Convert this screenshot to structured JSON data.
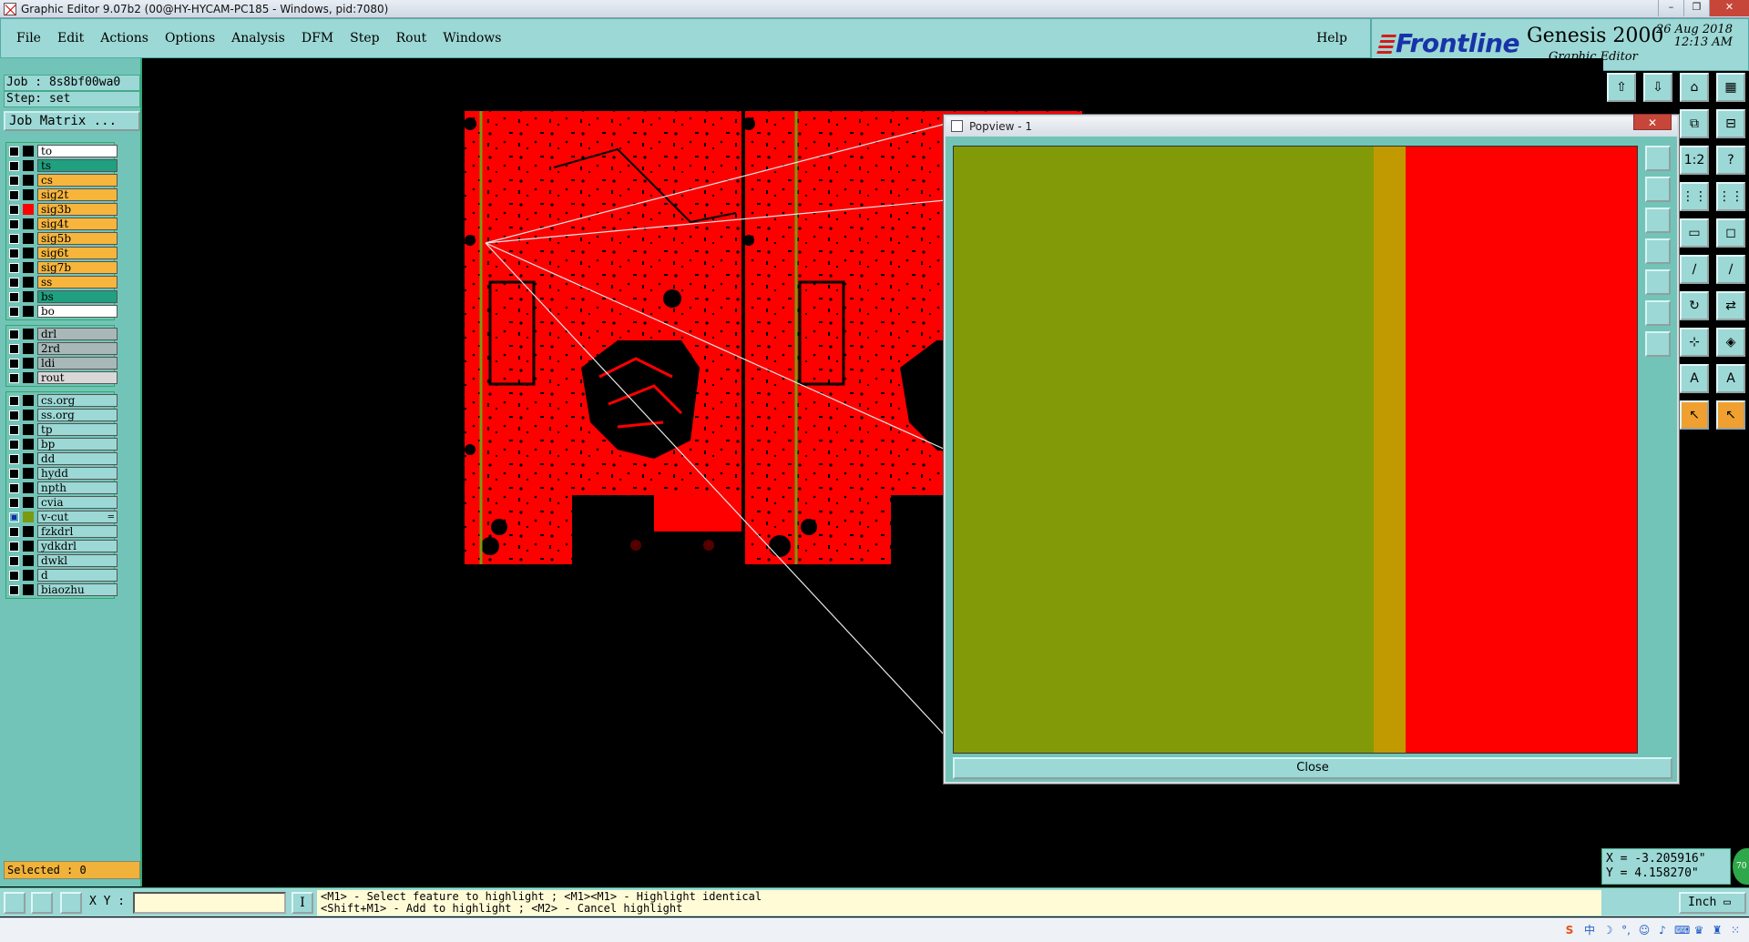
{
  "window": {
    "title": "Graphic Editor 9.07b2 (00@HY-HYCAM-PC185 - Windows, pid:7080)",
    "min_label": "–",
    "max_label": "❐",
    "close_label": "✕"
  },
  "menu": {
    "items": [
      "File",
      "Edit",
      "Actions",
      "Options",
      "Analysis",
      "DFM",
      "Step",
      "Rout",
      "Windows"
    ],
    "help": "Help"
  },
  "logo": {
    "brand": "Frontline",
    "product": "Genesis 2000",
    "subtitle": "Graphic Editor",
    "date": "26 Aug 2018",
    "time": "12:13 AM"
  },
  "job": {
    "job_label": "Job : 8s8bf00wa0",
    "step_label": "Step: set",
    "matrix_button": "Job Matrix ..."
  },
  "layers": {
    "groups": [
      [
        {
          "name": "to",
          "bg": "#ffffff",
          "swatch": "#000000",
          "checked": false
        },
        {
          "name": "ts",
          "bg": "#20a080",
          "swatch": "#000000",
          "checked": false
        },
        {
          "name": "cs",
          "bg": "#f7b53c",
          "swatch": "#000000",
          "checked": false
        },
        {
          "name": "sig2t",
          "bg": "#f7b53c",
          "swatch": "#000000",
          "checked": false
        },
        {
          "name": "sig3b",
          "bg": "#f7b53c",
          "swatch": "#ff0000",
          "checked": false
        },
        {
          "name": "sig4t",
          "bg": "#f7b53c",
          "swatch": "#000000",
          "checked": false
        },
        {
          "name": "sig5b",
          "bg": "#f7b53c",
          "swatch": "#000000",
          "checked": false
        },
        {
          "name": "sig6t",
          "bg": "#f7b53c",
          "swatch": "#000000",
          "checked": false
        },
        {
          "name": "sig7b",
          "bg": "#f7b53c",
          "swatch": "#000000",
          "checked": false
        },
        {
          "name": "ss",
          "bg": "#f7b53c",
          "swatch": "#000000",
          "checked": false
        },
        {
          "name": "bs",
          "bg": "#20a080",
          "swatch": "#000000",
          "checked": false
        },
        {
          "name": "bo",
          "bg": "#ffffff",
          "swatch": "#000000",
          "checked": false
        }
      ],
      [
        {
          "name": "drl",
          "bg": "#a8b8b8",
          "swatch": "#000000",
          "checked": false
        },
        {
          "name": "2rd",
          "bg": "#a8b8b8",
          "swatch": "#000000",
          "checked": false
        },
        {
          "name": "ldi",
          "bg": "#a8b8b8",
          "swatch": "#000000",
          "checked": false
        },
        {
          "name": "rout",
          "bg": "#d8d8d8",
          "swatch": "#000000",
          "checked": false
        }
      ],
      [
        {
          "name": "cs.org",
          "bg": "#9cd8d5",
          "swatch": "#000000",
          "checked": false
        },
        {
          "name": "ss.org",
          "bg": "#9cd8d5",
          "swatch": "#000000",
          "checked": false
        },
        {
          "name": "tp",
          "bg": "#9cd8d5",
          "swatch": "#000000",
          "checked": false
        },
        {
          "name": "bp",
          "bg": "#9cd8d5",
          "swatch": "#000000",
          "checked": false
        },
        {
          "name": "dd",
          "bg": "#9cd8d5",
          "swatch": "#000000",
          "checked": false
        },
        {
          "name": "hydd",
          "bg": "#9cd8d5",
          "swatch": "#000000",
          "checked": false
        },
        {
          "name": "npth",
          "bg": "#9cd8d5",
          "swatch": "#000000",
          "checked": false
        },
        {
          "name": "cvia",
          "bg": "#9cd8d5",
          "swatch": "#000000",
          "checked": false
        },
        {
          "name": "v-cut",
          "bg": "#9cd8d5",
          "swatch": "#7a9a10",
          "checked": true,
          "mark": "="
        },
        {
          "name": "fzkdrl",
          "bg": "#9cd8d5",
          "swatch": "#000000",
          "checked": false
        },
        {
          "name": "ydkdrl",
          "bg": "#9cd8d5",
          "swatch": "#000000",
          "checked": false
        },
        {
          "name": "dwkl",
          "bg": "#9cd8d5",
          "swatch": "#000000",
          "checked": false
        },
        {
          "name": "d",
          "bg": "#9cd8d5",
          "swatch": "#000000",
          "checked": false
        },
        {
          "name": "biaozhu",
          "bg": "#9cd8d5",
          "swatch": "#000000",
          "checked": false
        }
      ]
    ]
  },
  "selected_label": "Selected : 0",
  "popview": {
    "title": "Popview - 1",
    "close_x": "✕",
    "close_button": "Close",
    "colors": {
      "vcut": "#829a08",
      "edge": "#c09a00",
      "copper": "#ff0000"
    }
  },
  "coords": {
    "x": "X = -3.205916\"",
    "y": "Y =  4.158270\"",
    "badge": "70"
  },
  "bottom": {
    "xy_label": "X Y :",
    "xy_value": "",
    "hint_icon": "I",
    "hint_line1": "<M1> - Select feature to highlight ; <M1><M1> - Highlight identical",
    "hint_line2": "<Shift+M1> - Add to highlight ; <M2> - Cancel highlight",
    "unit": "Inch"
  },
  "colors": {
    "panel": "#9cd8d5",
    "panel_dark": "#72c4b8",
    "board_red": "#ff0000",
    "vcut_line": "#7a9a10"
  }
}
